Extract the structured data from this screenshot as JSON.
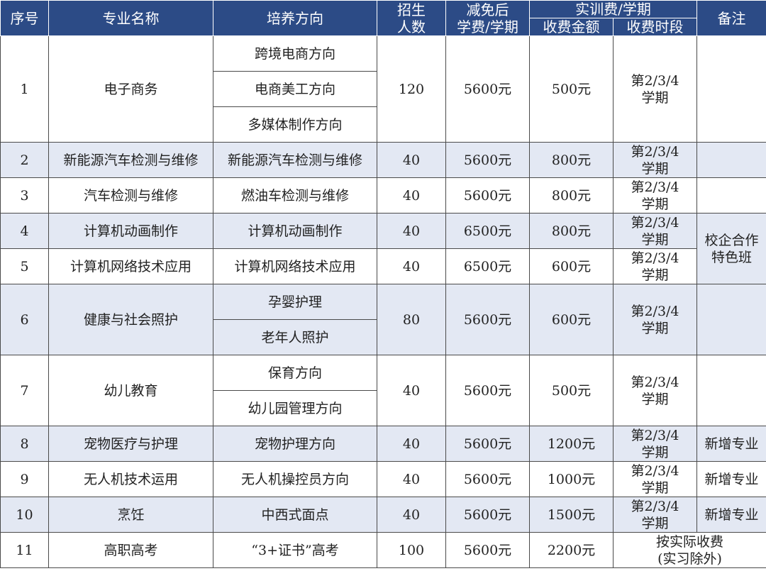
{
  "headers": {
    "seq": "序号",
    "major": "专业名称",
    "direction": "培养方向",
    "enroll": "招生\n人数",
    "tuition": "减免后\n学费/学期",
    "training": "实训费/学期",
    "fee_amount": "收费金额",
    "fee_period": "收费时段",
    "remark": "备注"
  },
  "rows": {
    "r1": {
      "seq": "1",
      "major": "电子商务",
      "dirs": [
        "跨境电商方向",
        "电商美工方向",
        "多媒体制作方向"
      ],
      "enroll": "120",
      "tuition": "5600元",
      "fee": "500元",
      "period": "第2/3/4\n学期"
    },
    "r2": {
      "seq": "2",
      "major": "新能源汽车检测与维修",
      "dir": "新能源汽车检测与维修",
      "enroll": "40",
      "tuition": "5600元",
      "fee": "800元",
      "period": "第2/3/4\n学期"
    },
    "r3": {
      "seq": "3",
      "major": "汽车检测与维修",
      "dir": "燃油车检测与维修",
      "enroll": "40",
      "tuition": "5600元",
      "fee": "800元",
      "period": "第2/3/4\n学期"
    },
    "r4": {
      "seq": "4",
      "major": "计算机动画制作",
      "dir": "计算机动画制作",
      "enroll": "40",
      "tuition": "6500元",
      "fee": "800元",
      "period": "第2/3/4\n学期"
    },
    "r5": {
      "seq": "5",
      "major": "计算机网络技术应用",
      "dir": "计算机网络技术应用",
      "enroll": "40",
      "tuition": "6500元",
      "fee": "600元",
      "period": "第2/3/4\n学期"
    },
    "r6": {
      "seq": "6",
      "major": "健康与社会照护",
      "dirs": [
        "孕婴护理",
        "老年人照护"
      ],
      "enroll": "80",
      "tuition": "5600元",
      "fee": "600元",
      "period": "第2/3/4\n学期"
    },
    "r7": {
      "seq": "7",
      "major": "幼儿教育",
      "dirs": [
        "保育方向",
        "幼儿园管理方向"
      ],
      "enroll": "40",
      "tuition": "5600元",
      "fee": "500元",
      "period": "第2/3/4\n学期"
    },
    "r8": {
      "seq": "8",
      "major": "宠物医疗与护理",
      "dir": "宠物护理方向",
      "enroll": "40",
      "tuition": "5600元",
      "fee": "1200元",
      "period": "第2/3/4\n学期",
      "remark": "新增专业"
    },
    "r9": {
      "seq": "9",
      "major": "无人机技术运用",
      "dir": "无人机操控员方向",
      "enroll": "40",
      "tuition": "5600元",
      "fee": "1000元",
      "period": "第2/3/4\n学期",
      "remark": "新增专业"
    },
    "r10": {
      "seq": "10",
      "major": "烹饪",
      "dir": "中西式面点",
      "enroll": "40",
      "tuition": "5600元",
      "fee": "1500元",
      "period": "第2/3/4\n学期",
      "remark": "新增专业"
    },
    "r11": {
      "seq": "11",
      "major": "高职高考",
      "dir": "“3+证书”高考",
      "enroll": "100",
      "tuition": "5600元",
      "fee": "2200元",
      "period_remark": "按实际收费\n(实习除外)"
    }
  },
  "remark_4_5": "校企合作\n特色班",
  "colors": {
    "header_bg": "#2c4b86",
    "band_bg": "#e3e8f3"
  }
}
